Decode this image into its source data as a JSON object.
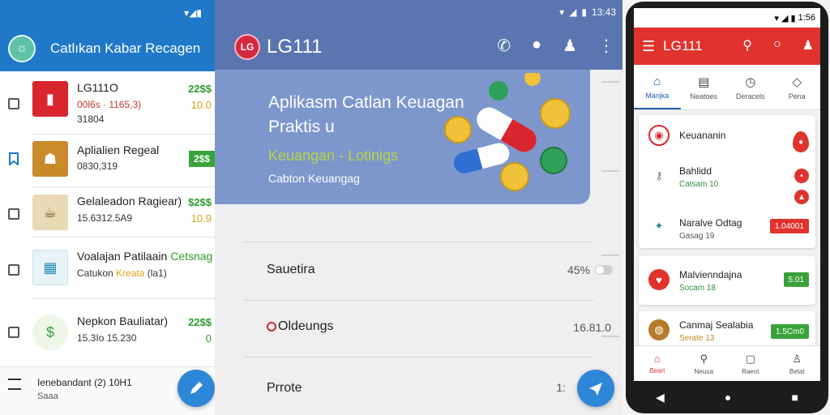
{
  "panel1": {
    "status_icons": "▾◢▮",
    "app_title": "Catlıkan Kabar Recagen",
    "items": [
      {
        "title": "LG111O",
        "sub": "00l6s · 1165,3)",
        "extra": "31804",
        "amount": "22$$",
        "amount2": "10.0"
      },
      {
        "title": "Aplialien Regeal",
        "sub": "0830,319",
        "amount": "2$$"
      },
      {
        "title": "Gelaleadon Ragiear)",
        "sub": "15.6312.5A9",
        "amount": "$2$$",
        "amount2": "10.9"
      },
      {
        "title": "Voalajan Patilaain",
        "title_extra": "Cetsnag",
        "sub": "Catukon",
        "sub_extra": "Kreata",
        "sub_extra2": "(la1)"
      },
      {
        "title": "Nepkon Bauliatar)",
        "sub": "15.3Io 15.230",
        "amount": "22$$",
        "amount2": "0"
      }
    ],
    "bottom_text1": "Ienebandant (2) 10H1",
    "bottom_text2": "Saaa"
  },
  "panel2": {
    "status_time": "13:43",
    "logo_text": "LG",
    "app_title": "LG111",
    "hero_title": "Aplikasm Catlan Keuagan Praktis u",
    "hero_subtitle": "Keuangan - Lotinigs",
    "hero_caption": "Cabton Keuangag",
    "list": [
      {
        "label": "Sauetira",
        "value": "45%"
      },
      {
        "label": "Oldeungs",
        "value": "16.81.0"
      },
      {
        "label": "Prrote",
        "value": "1:"
      }
    ]
  },
  "panel3": {
    "status_time": "1:56",
    "app_title": "LG111",
    "tabs": [
      {
        "label": "Manjka",
        "icon": "home-icon",
        "active": true
      },
      {
        "label": "Neatoes",
        "icon": "note-icon",
        "active": false
      },
      {
        "label": "Deracels",
        "icon": "clock-icon",
        "active": false
      },
      {
        "label": "Pena",
        "icon": "tag-icon",
        "active": false
      }
    ],
    "cards": [
      {
        "rows": [
          {
            "title": "Keuananin",
            "sub": ""
          },
          {
            "title": "Bahlidd",
            "sub": "Catsam 10"
          },
          {
            "title": "Naralve Odtag",
            "sub": "Gasag 19",
            "badge": "1.04001"
          }
        ]
      },
      {
        "title": "Malvienndajna",
        "sub": "Socam 18",
        "badge": "5.01"
      },
      {
        "title": "Canmaj Sealabia",
        "sub": "Serate 13",
        "badge": "1.5Cm0"
      }
    ],
    "bottom_nav": [
      {
        "label": "Beart",
        "icon": "home-icon",
        "active": true
      },
      {
        "label": "Neuua",
        "icon": "search-icon",
        "active": false
      },
      {
        "label": "Raeot",
        "icon": "note-icon",
        "active": false
      },
      {
        "label": "Betat",
        "icon": "person-icon",
        "active": false
      }
    ]
  },
  "colors": {
    "panel1_bar": "#1f78c8",
    "panel2_bar": "#5a75b0",
    "panel3_bar": "#e0332e",
    "green_badge": "#3aa23a"
  }
}
